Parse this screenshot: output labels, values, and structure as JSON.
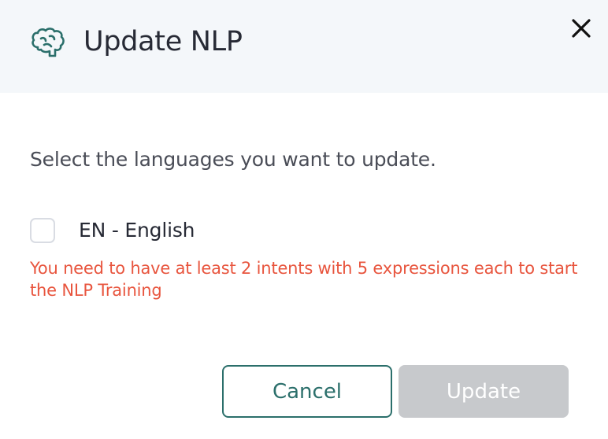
{
  "dialog": {
    "title": "Update NLP",
    "title_icon": "brain-icon",
    "close_icon": "close-icon",
    "prompt": "Select the languages you want to update.",
    "languages": [
      {
        "label": "EN - English",
        "checked": false
      }
    ],
    "error_message": "You need to have at least 2 intents with 5 expressions each to start the NLP Training",
    "buttons": {
      "cancel_label": "Cancel",
      "update_label": "Update",
      "update_disabled": true
    }
  },
  "colors": {
    "header_bg": "#f4f7fa",
    "accent": "#2b6f6b",
    "error": "#e8553e",
    "disabled_button": "#c7c9cc"
  }
}
